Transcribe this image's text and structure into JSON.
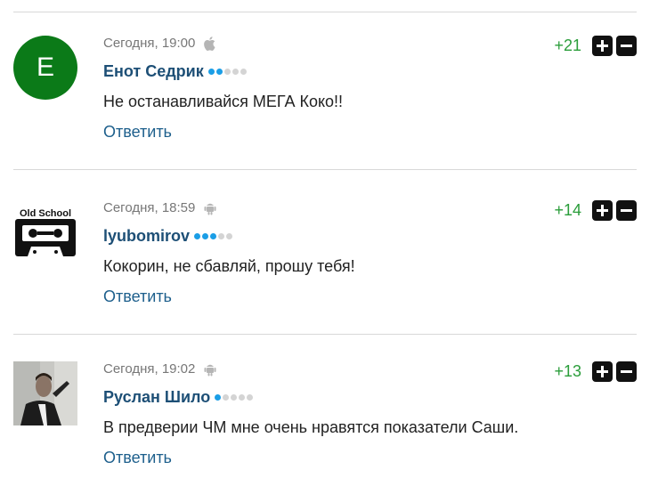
{
  "comments": [
    {
      "time": "Сегодня, 19:00",
      "device": "apple-icon",
      "author": "Енот Седрик",
      "level": 2,
      "text": "Не останавливайся МЕГА Коко!!",
      "reply": "Ответить",
      "score": "+21",
      "avatar": {
        "type": "letter",
        "letter": "E",
        "color": "#0b7a18"
      }
    },
    {
      "time": "Сегодня, 18:59",
      "device": "android-icon",
      "author": "lyubomirov",
      "level": 3,
      "text": "Кокорин, не сбавляй, прошу тебя!",
      "reply": "Ответить",
      "score": "+14",
      "avatar": {
        "type": "image",
        "caption": "Old School"
      }
    },
    {
      "time": "Сегодня, 19:02",
      "device": "android-icon",
      "author": "Руслан Шило",
      "level": 1,
      "text": "В предверии ЧМ мне очень нравятся показатели Саши.",
      "reply": "Ответить",
      "score": "+13",
      "avatar": {
        "type": "image"
      }
    }
  ],
  "colors": {
    "score": "#2a9d3a",
    "author": "#1d4f76",
    "link": "#1d5f8c",
    "dot_active": "#1b9ee6",
    "dot_inactive": "#d4d4d4"
  }
}
